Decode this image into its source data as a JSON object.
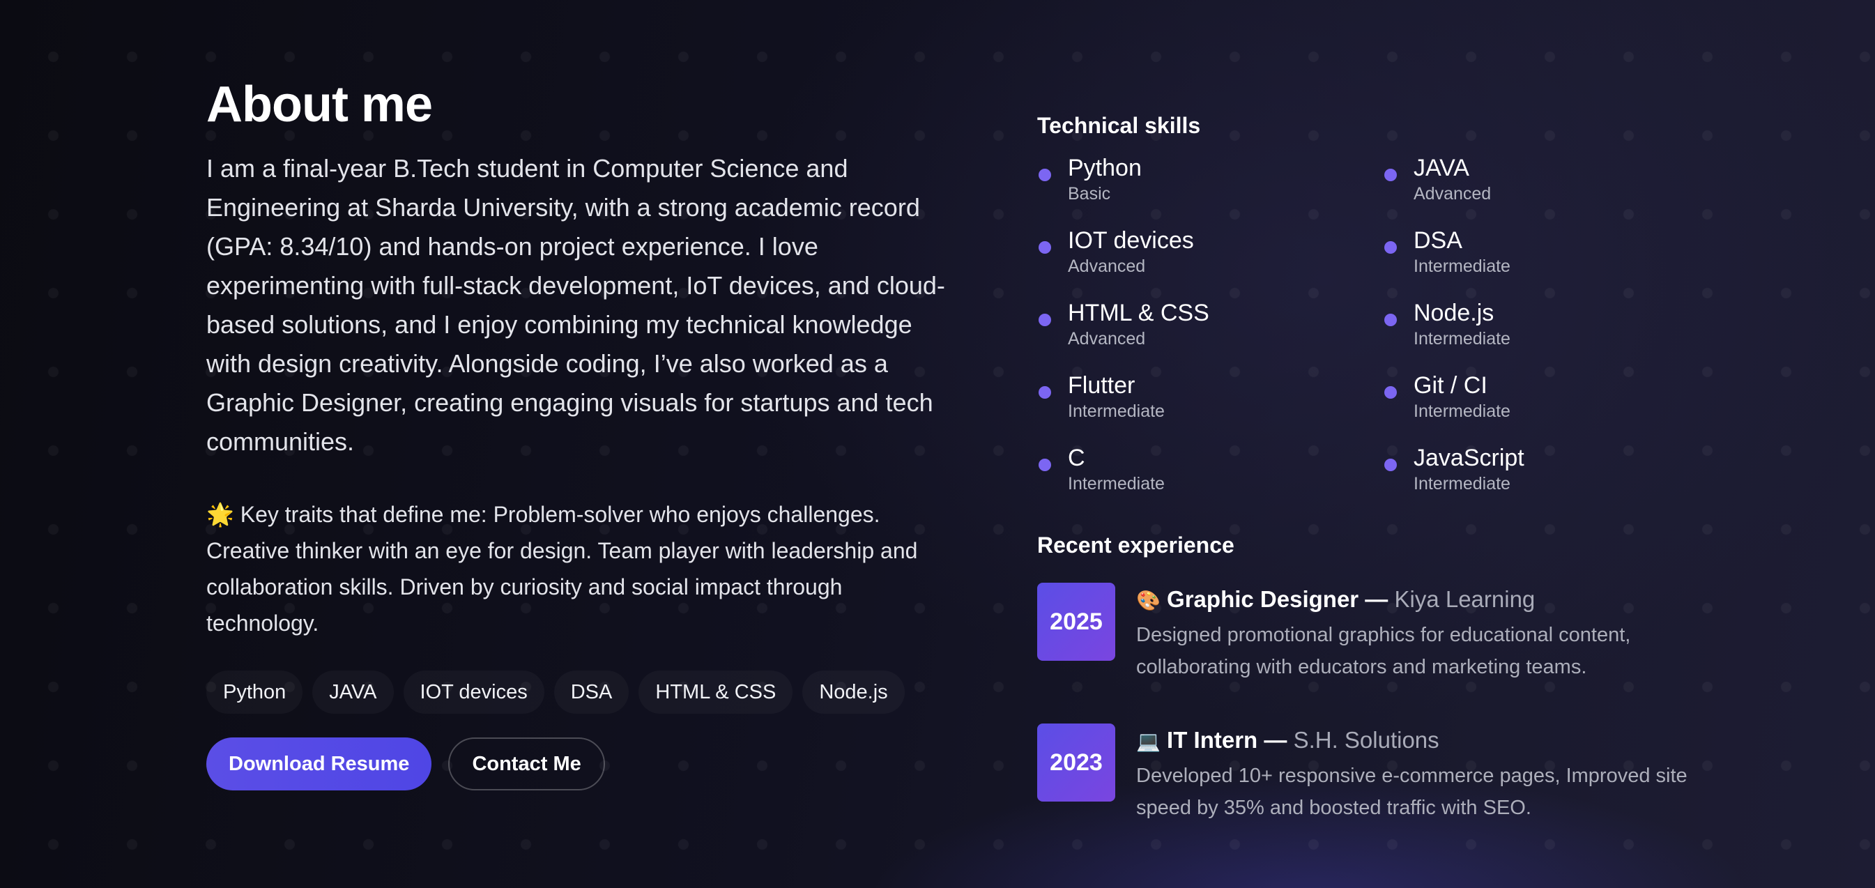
{
  "about": {
    "title": "About me",
    "paragraph": "I am a final-year B.Tech student in Computer Science and Engineering at Sharda University, with a strong academic record (GPA: 8.34/10) and hands-on project experience. I love experimenting with full-stack development, IoT devices, and cloud-based solutions, and I enjoy combining my technical knowledge with design creativity. Alongside coding, I’ve also worked as a Graphic Designer, creating engaging visuals for startups and tech communities.",
    "traits": "🌟 Key traits that define me: Problem-solver who enjoys challenges. Creative thinker with an eye for design. Team player with leadership and collaboration skills. Driven by curiosity and social impact through technology.",
    "chips": [
      "Python",
      "JAVA",
      "IOT devices",
      "DSA",
      "HTML & CSS",
      "Node.js"
    ],
    "buttons": {
      "download": "Download Resume",
      "contact": "Contact Me"
    }
  },
  "skills": {
    "heading": "Technical skills",
    "items": [
      {
        "name": "Python",
        "level": "Basic"
      },
      {
        "name": "JAVA",
        "level": "Advanced"
      },
      {
        "name": "IOT devices",
        "level": "Advanced"
      },
      {
        "name": "DSA",
        "level": "Intermediate"
      },
      {
        "name": "HTML & CSS",
        "level": "Advanced"
      },
      {
        "name": "Node.js",
        "level": "Intermediate"
      },
      {
        "name": "Flutter",
        "level": "Intermediate"
      },
      {
        "name": "Git / CI",
        "level": "Intermediate"
      },
      {
        "name": "C",
        "level": "Intermediate"
      },
      {
        "name": "JavaScript",
        "level": "Intermediate"
      }
    ]
  },
  "experience": {
    "heading": "Recent experience",
    "items": [
      {
        "year": "2025",
        "emoji": "🎨",
        "role": "Graphic Designer —",
        "company": "Kiya Learning",
        "description": "Designed promotional graphics for educational content, collaborating with educators and marketing teams."
      },
      {
        "year": "2023",
        "emoji": "💻",
        "role": "IT Intern —",
        "company": "S.H. Solutions",
        "description": "Developed 10+ responsive e-commerce pages, Improved site speed by 35% and boosted traffic with SEO."
      }
    ]
  },
  "colors": {
    "accent": "#5b4ee6",
    "skill_dot": "#7c66f2",
    "background": "#111120"
  }
}
